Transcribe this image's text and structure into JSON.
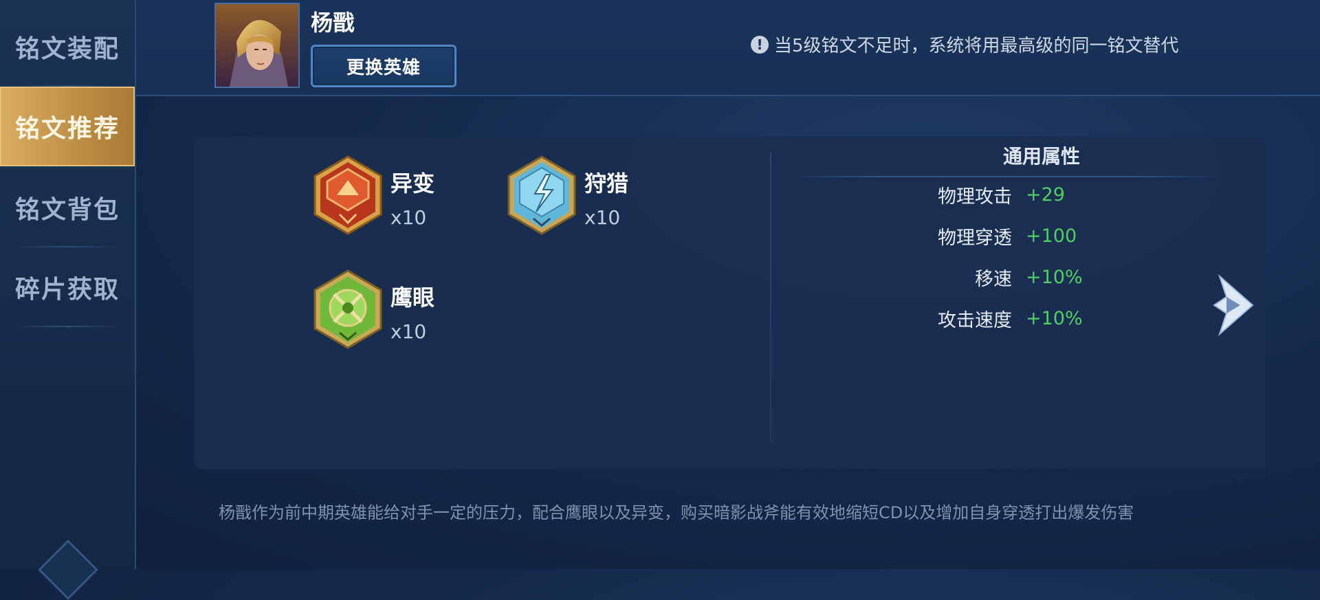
{
  "sidebar": {
    "items": [
      {
        "label": "铭文装配"
      },
      {
        "label": "铭文推荐"
      },
      {
        "label": "铭文背包"
      },
      {
        "label": "碎片获取"
      }
    ]
  },
  "header": {
    "hero_name": "杨戬",
    "change_hero_label": "更换英雄",
    "notice": "当5级铭文不足时，系统将用最高级的同一铭文替代"
  },
  "runes": [
    {
      "name": "异变",
      "count": "x10",
      "color": "#c9462a",
      "icon": "red-hexagon-rune-icon"
    },
    {
      "name": "狩猎",
      "count": "x10",
      "color": "#5fb6d8",
      "icon": "blue-hexagon-rune-icon"
    },
    {
      "name": "鹰眼",
      "count": "x10",
      "color": "#7fc84a",
      "icon": "green-hexagon-rune-icon"
    }
  ],
  "attributes": {
    "title": "通用属性",
    "rows": [
      {
        "label": "物理攻击",
        "value": "+29"
      },
      {
        "label": "物理穿透",
        "value": "+100"
      },
      {
        "label": "移速",
        "value": "+10%"
      },
      {
        "label": "攻击速度",
        "value": "+10%"
      }
    ]
  },
  "description": "杨戬作为前中期英雄能给对手一定的压力，配合鹰眼以及异变，购买暗影战斧能有效地缩短CD以及增加自身穿透打出爆发伤害",
  "colors": {
    "accent_gold": "#c99a52",
    "positive_green": "#4fcf63",
    "button_border": "#4f86c6"
  }
}
